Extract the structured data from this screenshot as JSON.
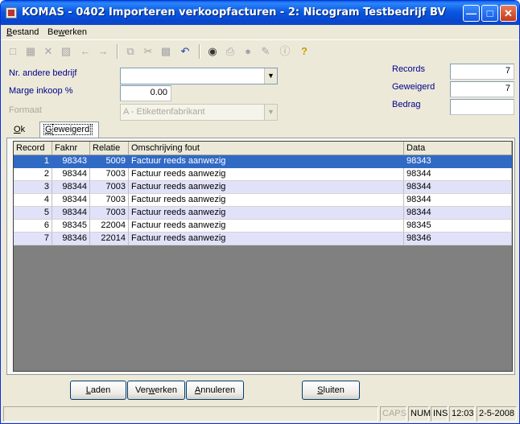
{
  "window": {
    "title": "KOMAS - 0402 Importeren verkoopfacturen - 2: Nicogram Testbedrijf BV"
  },
  "menu": [
    {
      "pre": "",
      "key": "B",
      "post": "estand"
    },
    {
      "pre": "Be",
      "key": "w",
      "post": "erken"
    }
  ],
  "toolbar_icons": [
    "new-icon",
    "save-icon",
    "delete-icon",
    "save-as-icon",
    "back-arrow-icon",
    "forward-arrow-icon",
    "copy-icon",
    "cut-icon",
    "paste-icon",
    "undo-icon",
    "find-icon",
    "print-icon",
    "help-balloon-icon",
    "edit-icon",
    "info-icon",
    "question-icon"
  ],
  "form": {
    "nr_andere_bedrijf": {
      "label": "Nr. andere bedrijf",
      "value": ""
    },
    "marge_inkoop": {
      "label": "Marge inkoop %",
      "value": "0.00"
    },
    "formaat": {
      "label": "Formaat",
      "value": "A - Etikettenfabrikant"
    },
    "records": {
      "label": "Records",
      "value": "7"
    },
    "geweigerd": {
      "label": "Geweigerd",
      "value": "7"
    },
    "bedrag": {
      "label": "Bedrag",
      "value": ""
    }
  },
  "tabs": [
    {
      "key": "O",
      "rest": "k"
    },
    {
      "key": "G",
      "rest": "eweigerd",
      "active": true
    }
  ],
  "grid": {
    "columns": [
      "Record",
      "Faknr",
      "Relatie",
      "Omschrijving fout",
      "Data"
    ],
    "rows": [
      [
        "1",
        "98343",
        "5009",
        "Factuur reeds aanwezig",
        "98343"
      ],
      [
        "2",
        "98344",
        "7003",
        "Factuur reeds aanwezig",
        "98344"
      ],
      [
        "3",
        "98344",
        "7003",
        "Factuur reeds aanwezig",
        "98344"
      ],
      [
        "4",
        "98344",
        "7003",
        "Factuur reeds aanwezig",
        "98344"
      ],
      [
        "5",
        "98344",
        "7003",
        "Factuur reeds aanwezig",
        "98344"
      ],
      [
        "6",
        "98345",
        "22004",
        "Factuur reeds aanwezig",
        "98345"
      ],
      [
        "7",
        "98346",
        "22014",
        "Factuur reeds aanwezig",
        "98346"
      ]
    ],
    "selected_row": 0
  },
  "buttons": {
    "laden": {
      "key": "L",
      "rest": "aden"
    },
    "verwerken": {
      "pre": "Ver",
      "key": "w",
      "rest": "erken"
    },
    "annuleren": {
      "key": "A",
      "rest": "nnuleren"
    },
    "sluiten": {
      "key": "S",
      "rest": "luiten"
    }
  },
  "status": {
    "caps": "CAPS",
    "num": "NUM",
    "ins": "INS",
    "time": "12:03",
    "date": "2-5-2008"
  }
}
